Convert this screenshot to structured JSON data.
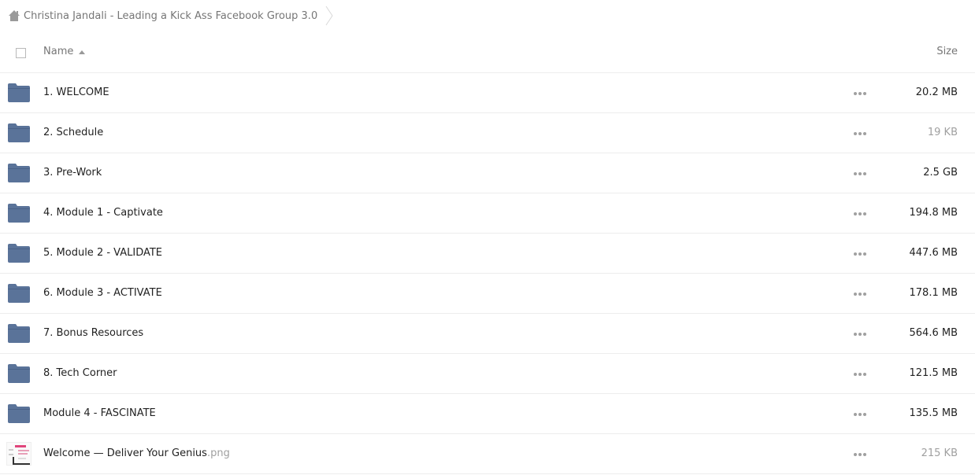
{
  "breadcrumb": {
    "folder_title": "Christina Jandali - Leading a Kick Ass Facebook Group 3.0"
  },
  "header": {
    "name_label": "Name",
    "size_label": "Size"
  },
  "files": [
    {
      "name": "1. WELCOME",
      "ext": "",
      "size": "20.2 MB",
      "type": "folder",
      "small": false
    },
    {
      "name": "2. Schedule",
      "ext": "",
      "size": "19 KB",
      "type": "folder",
      "small": true
    },
    {
      "name": "3. Pre-Work",
      "ext": "",
      "size": "2.5 GB",
      "type": "folder",
      "small": false
    },
    {
      "name": "4. Module 1 - Captivate",
      "ext": "",
      "size": "194.8 MB",
      "type": "folder",
      "small": false
    },
    {
      "name": "5. Module 2 - VALIDATE",
      "ext": "",
      "size": "447.6 MB",
      "type": "folder",
      "small": false
    },
    {
      "name": "6. Module 3 - ACTIVATE",
      "ext": "",
      "size": "178.1 MB",
      "type": "folder",
      "small": false
    },
    {
      "name": "7. Bonus Resources",
      "ext": "",
      "size": "564.6 MB",
      "type": "folder",
      "small": false
    },
    {
      "name": "8. Tech Corner",
      "ext": "",
      "size": "121.5 MB",
      "type": "folder",
      "small": false
    },
    {
      "name": "Module 4 - FASCINATE",
      "ext": "",
      "size": "135.5 MB",
      "type": "folder",
      "small": false
    },
    {
      "name": "Welcome — Deliver Your Genius",
      "ext": ".png",
      "size": "215 KB",
      "type": "image",
      "small": true
    }
  ],
  "icons": {
    "home": "home-icon",
    "folder": "folder-icon",
    "more": "more-options-icon",
    "sort": "sort-ascending-icon",
    "chevron": "chevron-right-icon"
  },
  "colors": {
    "folder": "#5a7399",
    "muted_text": "#767676",
    "divider": "#ededed"
  }
}
